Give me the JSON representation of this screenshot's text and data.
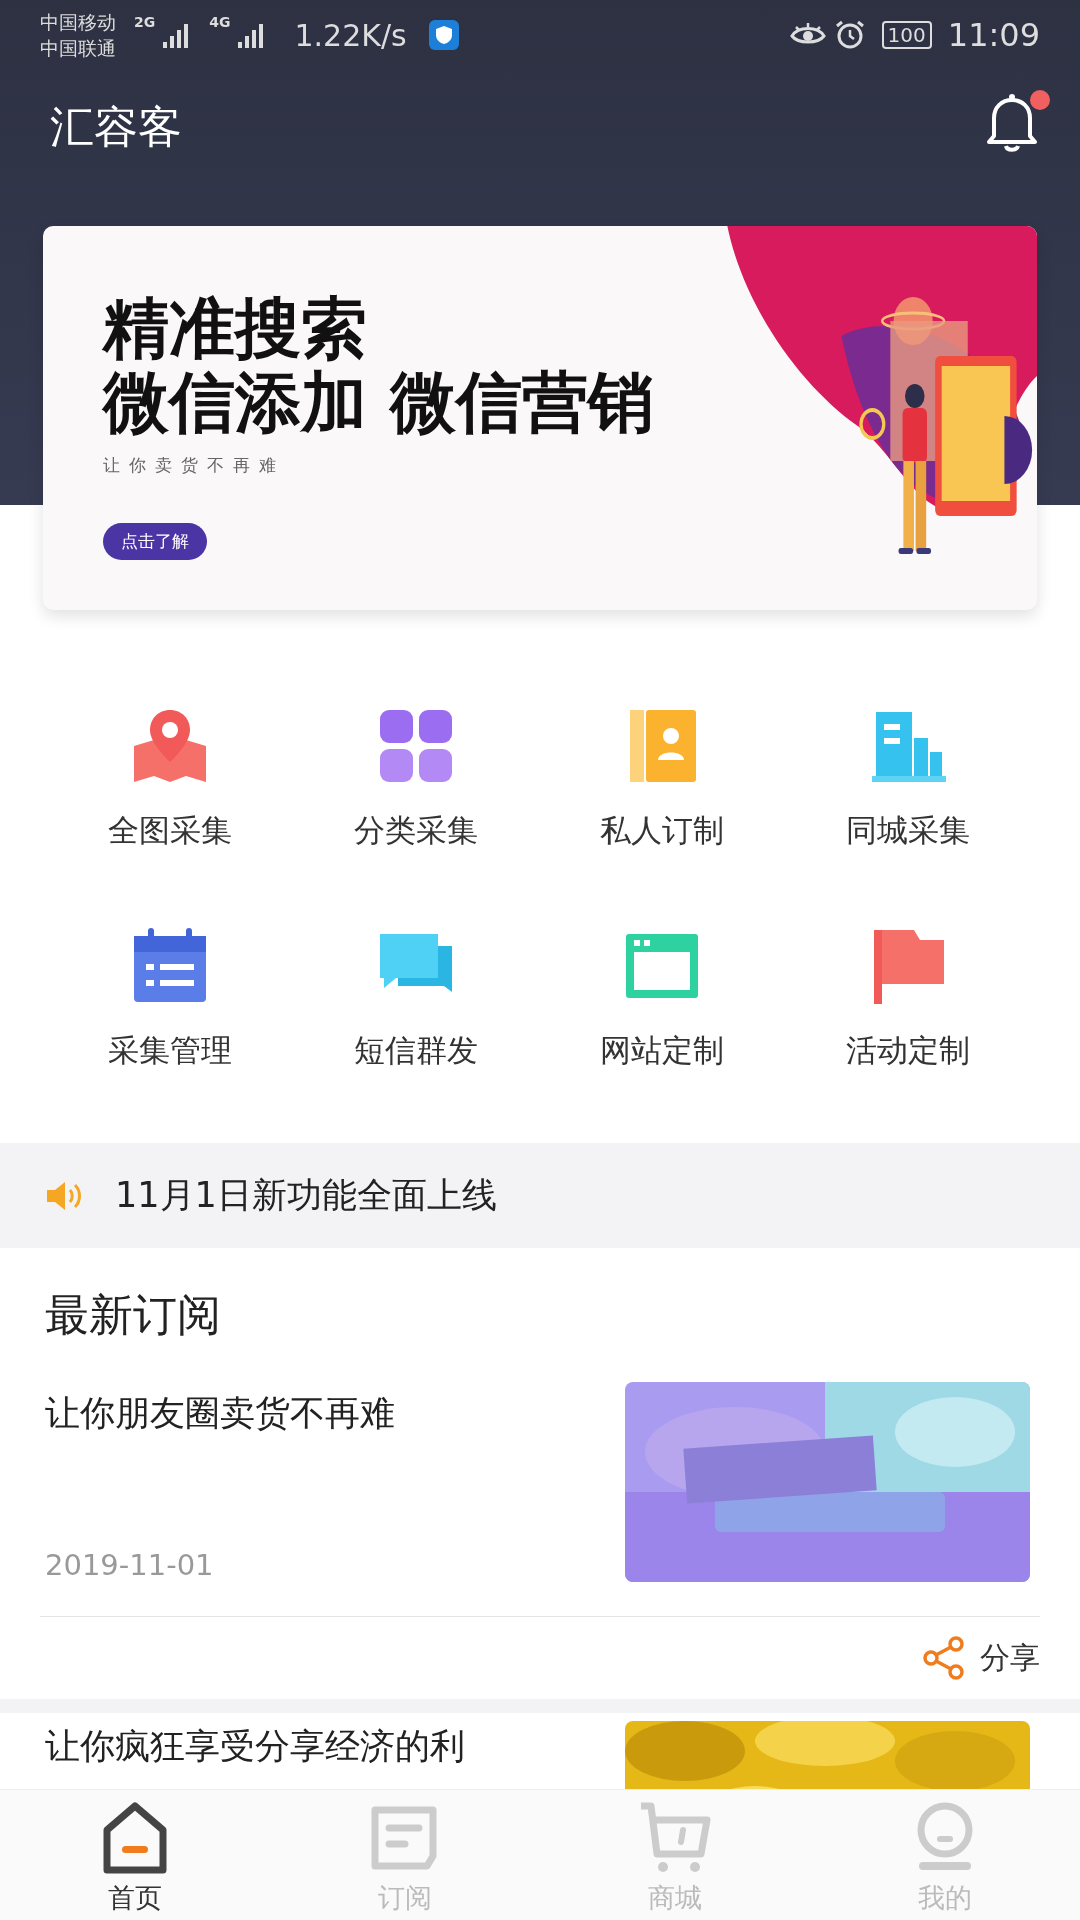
{
  "status_bar": {
    "carriers": [
      "中国移动",
      "中国联通"
    ],
    "networks": [
      "2G",
      "4G"
    ],
    "speed": "1.22K/s",
    "battery": "100",
    "time": "11:09"
  },
  "header": {
    "title": "汇容客",
    "unread": true
  },
  "banner": {
    "headline": [
      "精准搜索",
      "微信添加 微信营销"
    ],
    "subtitle": "让你卖货不再难",
    "button": "点击了解"
  },
  "features": [
    {
      "label": "全图采集"
    },
    {
      "label": "分类采集"
    },
    {
      "label": "私人订制"
    },
    {
      "label": "同城采集"
    },
    {
      "label": "采集管理"
    },
    {
      "label": "短信群发"
    },
    {
      "label": "网站定制"
    },
    {
      "label": "活动定制"
    }
  ],
  "notice": {
    "text": "11月1日新功能全面上线"
  },
  "section_title": "最新订阅",
  "articles": [
    {
      "title": "让你朋友圈卖货不再难",
      "date": "2019-11-01",
      "share": "分享"
    },
    {
      "title": "让你疯狂享受分享经济的利"
    }
  ],
  "tabs": [
    {
      "label": "首页",
      "selected": true
    },
    {
      "label": "订阅",
      "selected": false
    },
    {
      "label": "商城",
      "selected": false
    },
    {
      "label": "我的",
      "selected": false
    }
  ]
}
